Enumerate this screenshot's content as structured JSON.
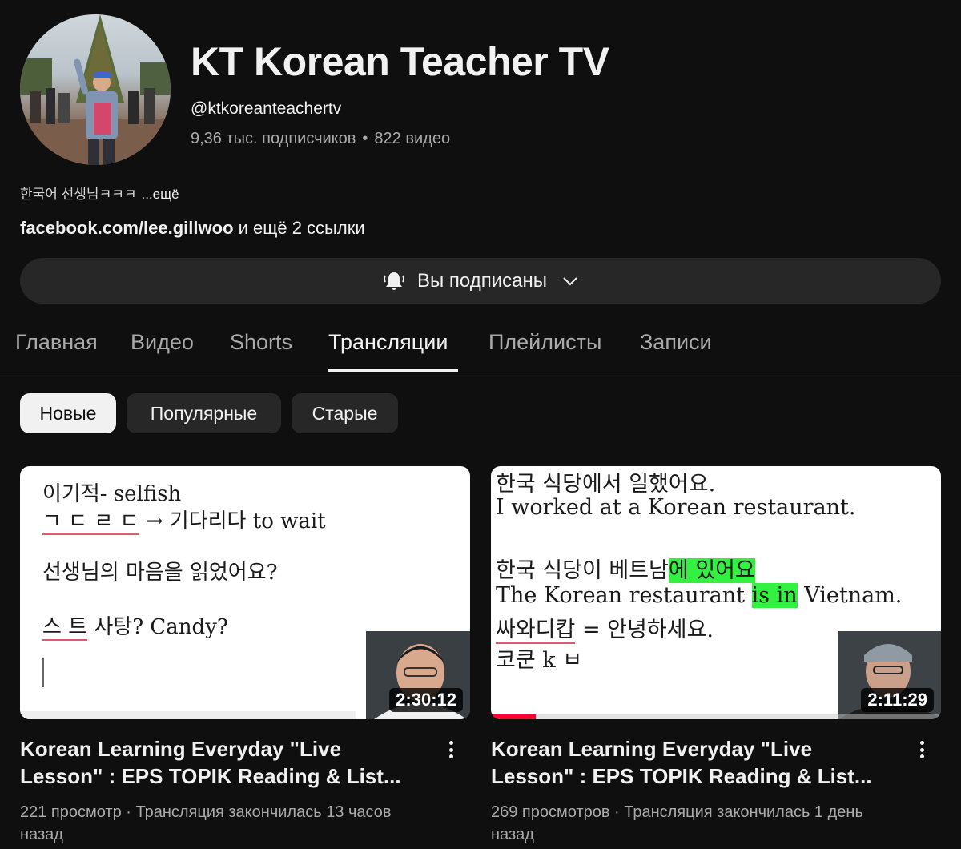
{
  "channel": {
    "title": "KT Korean Teacher TV",
    "handle": "@ktkoreanteachertv",
    "subscribers": "9,36 тыс. подписчиков",
    "separator": "•",
    "videos": "822 видео",
    "description": "한국어 선생님ㅋㅋㅋ",
    "description_more": "...ещё",
    "link_main": "facebook.com/lee.gillwoo",
    "link_more": " и ещё 2 ссылки"
  },
  "subscribe": {
    "label": "Вы подписаны",
    "icon": "bell-ringing-icon",
    "chevron": "chevron-down-icon"
  },
  "tabs": [
    {
      "label": "Главная",
      "active": false
    },
    {
      "label": "Видео",
      "active": false
    },
    {
      "label": "Shorts",
      "active": false
    },
    {
      "label": "Трансляции",
      "active": true
    },
    {
      "label": "Плейлисты",
      "active": false
    },
    {
      "label": "Записи",
      "active": false
    }
  ],
  "chips": [
    {
      "label": "Новые",
      "active": true
    },
    {
      "label": "Популярные",
      "active": false
    },
    {
      "label": "Старые",
      "active": false
    }
  ],
  "videos": [
    {
      "thumb_lines": [
        "이기적- selfish",
        "ㄱ ㄷ ㄹ ㄷ",
        "→ 기다리다 to wait",
        "선생님의 마음을 읽었어요?",
        "스 트",
        " 사탕? Candy?"
      ],
      "duration": "2:30:12",
      "title": "Korean Learning Everyday \"Live Lesson\"  : EPS TOPIK Reading & List...",
      "meta": "221 просмотр · Трансляция закончилась 13 часов назад",
      "progress_fraction": 0
    },
    {
      "thumb_lines": [
        "한국 식당에서 일했어요.",
        "I worked at a Korean restaurant.",
        "한국 식당이 베트남",
        "에 있어요",
        "The Korean restaurant ",
        "is in",
        " Vietnam.",
        "싸와디캅",
        " = 안녕하세요.",
        "코쿤 k ㅂ"
      ],
      "duration": "2:11:29",
      "title": "Korean Learning Everyday \"Live Lesson\"  : EPS TOPIK Reading & List...",
      "meta": "269 просмотров · Трансляция закончилась 1 день назад",
      "progress_fraction": 0.1
    }
  ],
  "colors": {
    "background": "#0f0f0f",
    "surface": "#272727",
    "text_primary": "#f1f1f1",
    "text_secondary": "#aaaaaa",
    "highlight": "#33f23f",
    "progress": "#ff0033"
  }
}
